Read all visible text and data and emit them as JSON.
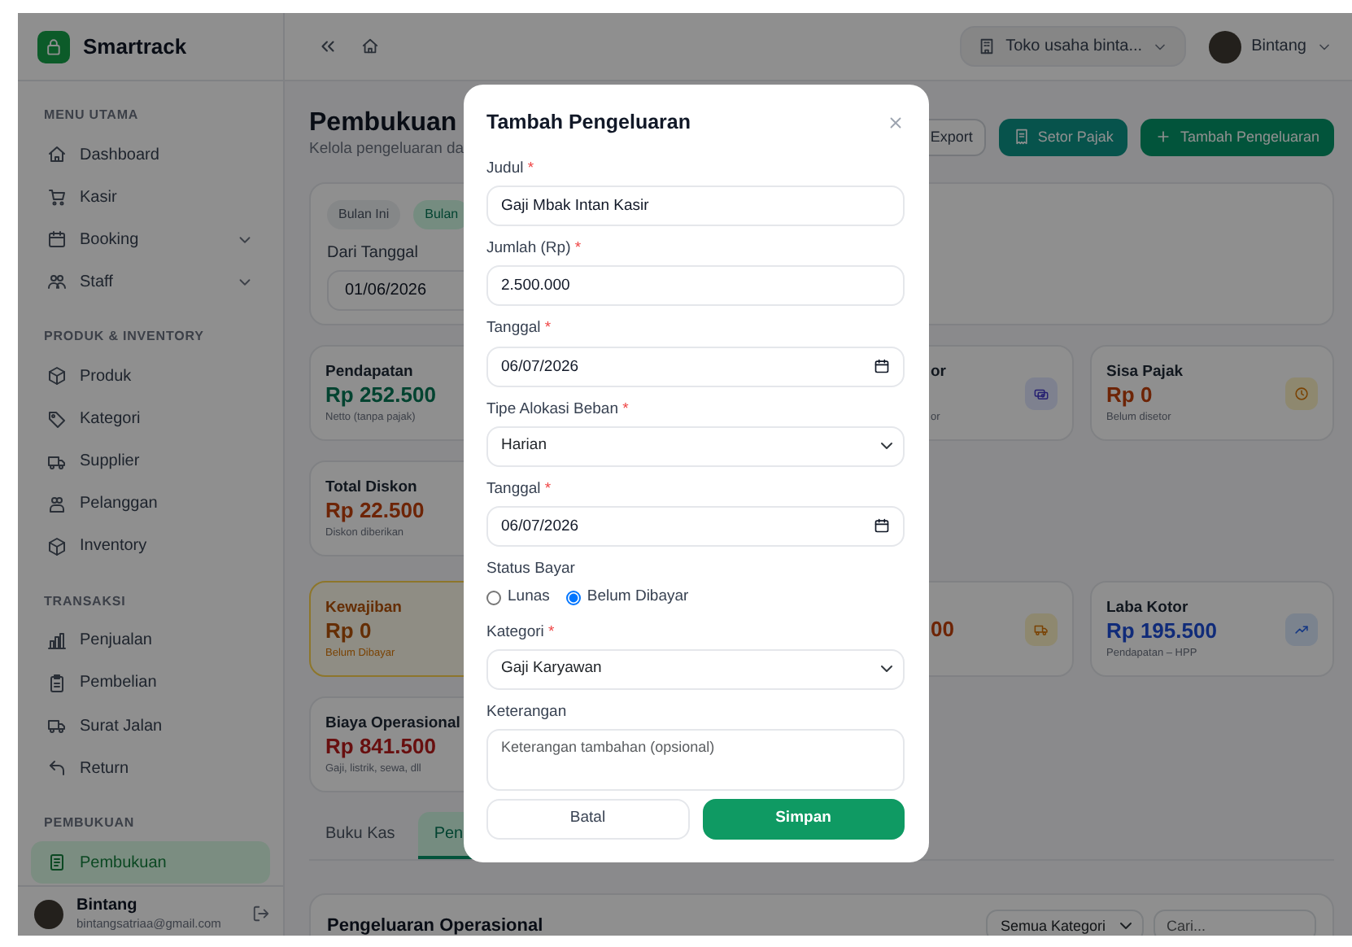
{
  "sidebar": {
    "brand": "Smartrack",
    "groups": [
      {
        "heading": "MENU UTAMA",
        "items": [
          {
            "label": "Dashboard",
            "kind": "link",
            "selected": false
          },
          {
            "label": "Kasir",
            "kind": "link",
            "selected": false
          },
          {
            "label": "Booking",
            "kind": "group",
            "selected": false
          },
          {
            "label": "Staff",
            "kind": "group",
            "selected": false
          }
        ]
      },
      {
        "heading": "PRODUK & INVENTORY",
        "items": [
          {
            "label": "Produk",
            "kind": "link",
            "selected": false
          },
          {
            "label": "Kategori",
            "kind": "link",
            "selected": false
          },
          {
            "label": "Supplier",
            "kind": "link",
            "selected": false
          },
          {
            "label": "Pelanggan",
            "kind": "link",
            "selected": false
          },
          {
            "label": "Inventory",
            "kind": "link",
            "selected": false
          }
        ]
      },
      {
        "heading": "TRANSAKSI",
        "items": [
          {
            "label": "Penjualan",
            "kind": "link",
            "selected": false
          },
          {
            "label": "Pembelian",
            "kind": "link",
            "selected": false
          },
          {
            "label": "Surat Jalan",
            "kind": "link",
            "selected": false
          },
          {
            "label": "Return",
            "kind": "link",
            "selected": false
          }
        ]
      },
      {
        "heading": "PEMBUKUAN",
        "items": [
          {
            "label": "Pembukuan",
            "kind": "link",
            "selected": true
          }
        ]
      }
    ],
    "user": {
      "name": "Bintang",
      "email": "bintangsatriaa@gmail.com"
    }
  },
  "topbar": {
    "store": "Toko usaha binta...",
    "user": "Bintang"
  },
  "header": {
    "title": "Pembukuan",
    "subtitle": "Kelola pengeluaran da",
    "buttons": [
      {
        "label": "Export",
        "kind": "outline"
      },
      {
        "label": "Setor Pajak",
        "kind": "teal"
      },
      {
        "label": "Tambah Pengeluaran",
        "kind": "primary"
      }
    ]
  },
  "filter": {
    "presets": [
      {
        "label": "Bulan Ini",
        "selected": false
      },
      {
        "label": "Bulan",
        "selected": true
      }
    ],
    "from_label": "Dari Tanggal",
    "from_value": "01/06/2026"
  },
  "stat_rows": [
    {
      "cards": [
        {
          "kind": "income",
          "label": "Pendapatan",
          "value": "Rp 252.500",
          "note": "Netto (tanpa pajak)",
          "highlight": false
        },
        {
          "kind": "tax-deposited",
          "label": "or",
          "note": "or",
          "highlight": false
        },
        {
          "kind": "pending-tax",
          "label": "Sisa Pajak",
          "value": "Rp 0",
          "note": "Belum disetor",
          "highlight": false
        }
      ]
    },
    {
      "cards": [
        {
          "kind": "discount",
          "label": "Total Diskon",
          "value": "Rp 22.500",
          "note": "Diskon diberikan",
          "highlight": false
        }
      ]
    },
    {
      "cards": [
        {
          "kind": "liability",
          "label": "Kewajiban",
          "value": "Rp 0",
          "note": "Belum Dibayar",
          "highlight": true
        },
        {
          "kind": "shipping",
          "value": "00",
          "highlight": false
        },
        {
          "kind": "profit",
          "label": "Laba Kotor",
          "value": "Rp 195.500",
          "note": "Pendapatan – HPP",
          "highlight": false
        }
      ]
    },
    {
      "cards": [
        {
          "kind": "expense",
          "label": "Biaya Operasional",
          "value": "Rp 841.500",
          "note": "Gaji, listrik, sewa, dll",
          "highlight": false
        }
      ]
    }
  ],
  "tabs": [
    {
      "label": "Buku Kas",
      "selected": false
    },
    {
      "label": "Pen",
      "selected": true
    }
  ],
  "table_card": {
    "title": "Pengeluaran Operasional",
    "filter": "Semua Kategori",
    "search_placeholder": "Cari..."
  },
  "modal": {
    "title": "Tambah Pengeluaran",
    "fields": [
      {
        "kind": "text",
        "label": "Judul",
        "mark": "*",
        "value": "Gaji Mbak Intan Kasir"
      },
      {
        "kind": "text",
        "label": "Jumlah (Rp)",
        "mark": "*",
        "value": "2.500.000"
      },
      {
        "kind": "date",
        "label": "Tanggal",
        "mark": "*",
        "value": "06/07/2026"
      },
      {
        "kind": "select",
        "label": "Tipe Alokasi Beban",
        "mark": "*",
        "value": "Harian"
      },
      {
        "kind": "date",
        "label": "Tanggal",
        "mark": "*",
        "value": "06/07/2026"
      },
      {
        "kind": "radio",
        "label": "Status Bayar",
        "options": [
          {
            "label": "Lunas",
            "selected": false
          },
          {
            "label": "Belum Dibayar",
            "selected": true
          }
        ]
      },
      {
        "kind": "select",
        "label": "Kategori",
        "mark": "*",
        "value": "Gaji Karyawan"
      },
      {
        "kind": "textarea",
        "label": "Keterangan",
        "placeholder": "Keterangan tambahan (opsional)"
      }
    ],
    "buttons": [
      {
        "label": "Batal",
        "kind": "secondary"
      },
      {
        "label": "Simpan",
        "kind": "primary"
      }
    ]
  }
}
